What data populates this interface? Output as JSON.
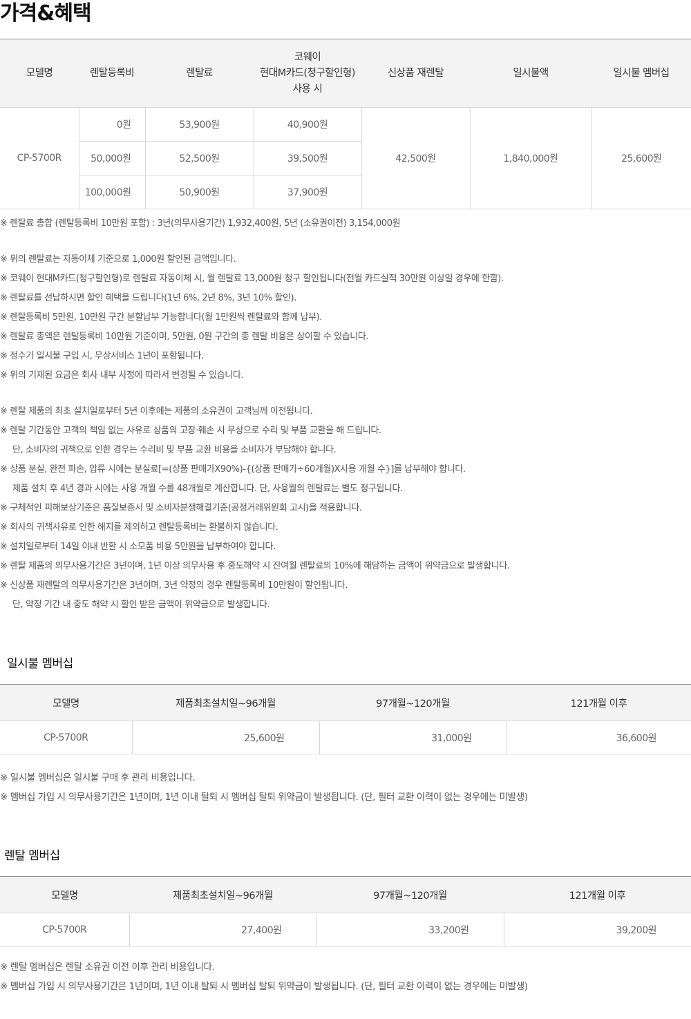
{
  "page_title": "가격&혜택",
  "price_table": {
    "headers": [
      "모델명",
      "렌탈등록비",
      "렌탈료",
      "코웨이",
      "현대M카드(청구할인형)",
      "사용 시",
      "신상품 재렌탈",
      "일시불액",
      "일시불 멤버십"
    ],
    "model": "CP-5700R",
    "rows": [
      {
        "reg": "0원",
        "rent": "53,900원",
        "card": "40,900원"
      },
      {
        "reg": "50,000원",
        "rent": "52,500원",
        "card": "39,500원"
      },
      {
        "reg": "100,000원",
        "rent": "50,900원",
        "card": "37,900원"
      }
    ],
    "rerental": "42,500원",
    "lump_sum": "1,840,000원",
    "lump_membership": "25,600원"
  },
  "notes": [
    "※ 렌탈료 총합 (렌탈등록비 10만원 포함) : 3년(의무사용기간) 1,932,400원, 5년 (소유권이전) 3,154,000원",
    "※ 위의 렌탈료는 자동이체 기준으로 1,000원 할인된 금액입니다.",
    "※ 코웨이 현대M카드(청구할인형)로 렌탈료 자동이체 시, 월 렌탈료 13,000원 청구 할인됩니다(전월 카드실적 30만원 이상일 경우에 한함).",
    "※ 렌탈료를 선납하시면 할인 혜택을 드립니다(1년 6%, 2년 8%, 3년 10% 할인).",
    "※ 렌탈등록비 5만원, 10만원 구간 분할납부 가능합니다(월 1만원씩 렌탈료와 함께 납부).",
    "※ 렌탈료 총액은 렌탈등록비 10만원 기준이며, 5만원, 0원 구간의 총 렌탈 비용은 상이할 수 있습니다.",
    "※ 정수기 일시불 구입 시, 무상서비스 1년이 포함됩니다.",
    "※ 위의 기재된 요금은 회사 내부 사정에 따라서 변경될 수 있습니다.",
    "※ 렌탈 제품의 최초 설치일로부터 5년 이후에는 제품의 소유권이 고객님께 이전됩니다.",
    "※ 렌탈 기간동안 고객의 책임 없는 사유로 상품의 고장·훼손 시 무상으로 수리 및 부품 교환을 해 드립니다.",
    "단, 소비자의 귀책으로 인한 경우는 수리비 및 부품 교환 비용을 소비자가 부담해야 합니다.",
    "※ 상품 분실, 완전 파손, 압류 시에는 분실료[=(상품 판매가X90%)-{(상품 판매가÷60개월)X사용 개월 수}]를 납부해야 합니다.",
    "제품 설치 후 4년 경과 시에는 사용 개월 수를 48개월로 계산합니다. 단, 사용월의 렌탈료는 별도 청구됩니다.",
    "※ 구체적인 피해보상기준은 품질보증서 및 소비자분쟁해결기준(공정거래위원회 고시)을 적용합니다.",
    "※ 회사의 귀책사유로 인한 해지를 제외하고 렌탈등록비는 환불하지 않습니다.",
    "※ 설치일로부터 14일 이내 반환 시 소모품 비용 5만원을 납부하여야 합니다.",
    "※ 렌탈 제품의 의무사용기간은 3년이며, 1년 이상 의무사용 후 중도해약 시 잔여월 렌탈료의 10%에 해당하는 금액이 위약금으로 발생합니다.",
    "※ 신상품 재렌탈의 의무사용기간은 3년이며, 3년 약정의 경우 렌탈등록비 10만원이 할인됩니다.",
    "단, 약정 기간 내 중도 해약 시 할인 받은 금액이 위약금으로 발생합니다."
  ],
  "lump_membership": {
    "title": "일시불 멤버십",
    "headers": [
      "모델명",
      "제품최초설치일~96개월",
      "97개월~120개월",
      "121개월 이후"
    ],
    "row": [
      "CP-5700R",
      "25,600원",
      "31,000원",
      "36,600원"
    ],
    "notes": [
      "※ 일시불 멤버십은 일시불 구매 후 관리 비용입니다.",
      "※ 멤버십 가입 시 의무사용기간은 1년이며, 1년 이내 탈퇴 시 멤버십 탈퇴 위약금이 발생됩니다. (단, 필터 교환 이력이 없는 경우에는 미발생)"
    ]
  },
  "rental_membership": {
    "title": "렌탈 멤버십",
    "headers": [
      "모델명",
      "제품최초설치일~96개월",
      "97개월~120개월",
      "121개월 이후"
    ],
    "row": [
      "CP-5700R",
      "27,400원",
      "33,200원",
      "39,200원"
    ],
    "notes": [
      "※ 렌탈 멤버십은 렌탈 소유권 이전 이후 관리 비용입니다.",
      "※ 멤버십 가입 시 의무사용기간은 1년이며, 1년 이내 탈퇴 시 멤버십 탈퇴 위약금이 발생됩니다. (단, 필터 교환 이력이 없는 경우에는 미발생)"
    ]
  }
}
